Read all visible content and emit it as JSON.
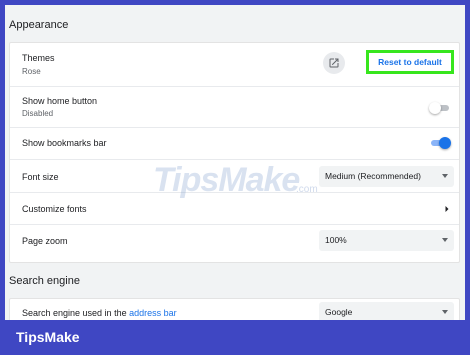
{
  "appearance": {
    "title": "Appearance",
    "themes": {
      "label": "Themes",
      "value": "Rose",
      "reset_label": "Reset to default",
      "open_icon": "open-in-new-icon"
    },
    "home_button": {
      "label": "Show home button",
      "value": "Disabled",
      "enabled": false
    },
    "bookmarks_bar": {
      "label": "Show bookmarks bar",
      "enabled": true
    },
    "font_size": {
      "label": "Font size",
      "selected": "Medium (Recommended)"
    },
    "customize_fonts": {
      "label": "Customize fonts"
    },
    "page_zoom": {
      "label": "Page zoom",
      "selected": "100%"
    }
  },
  "search_engine": {
    "title": "Search engine",
    "used_in": {
      "label_prefix": "Search engine used in the",
      "label_link": "address bar",
      "selected": "Google"
    }
  },
  "watermark": {
    "main": "TipsMake",
    "sub": ".com"
  },
  "footer": {
    "brand": "TipsMake"
  },
  "colors": {
    "background": "#3f47c3",
    "highlight": "#37e61d",
    "accent": "#1a73e8"
  }
}
